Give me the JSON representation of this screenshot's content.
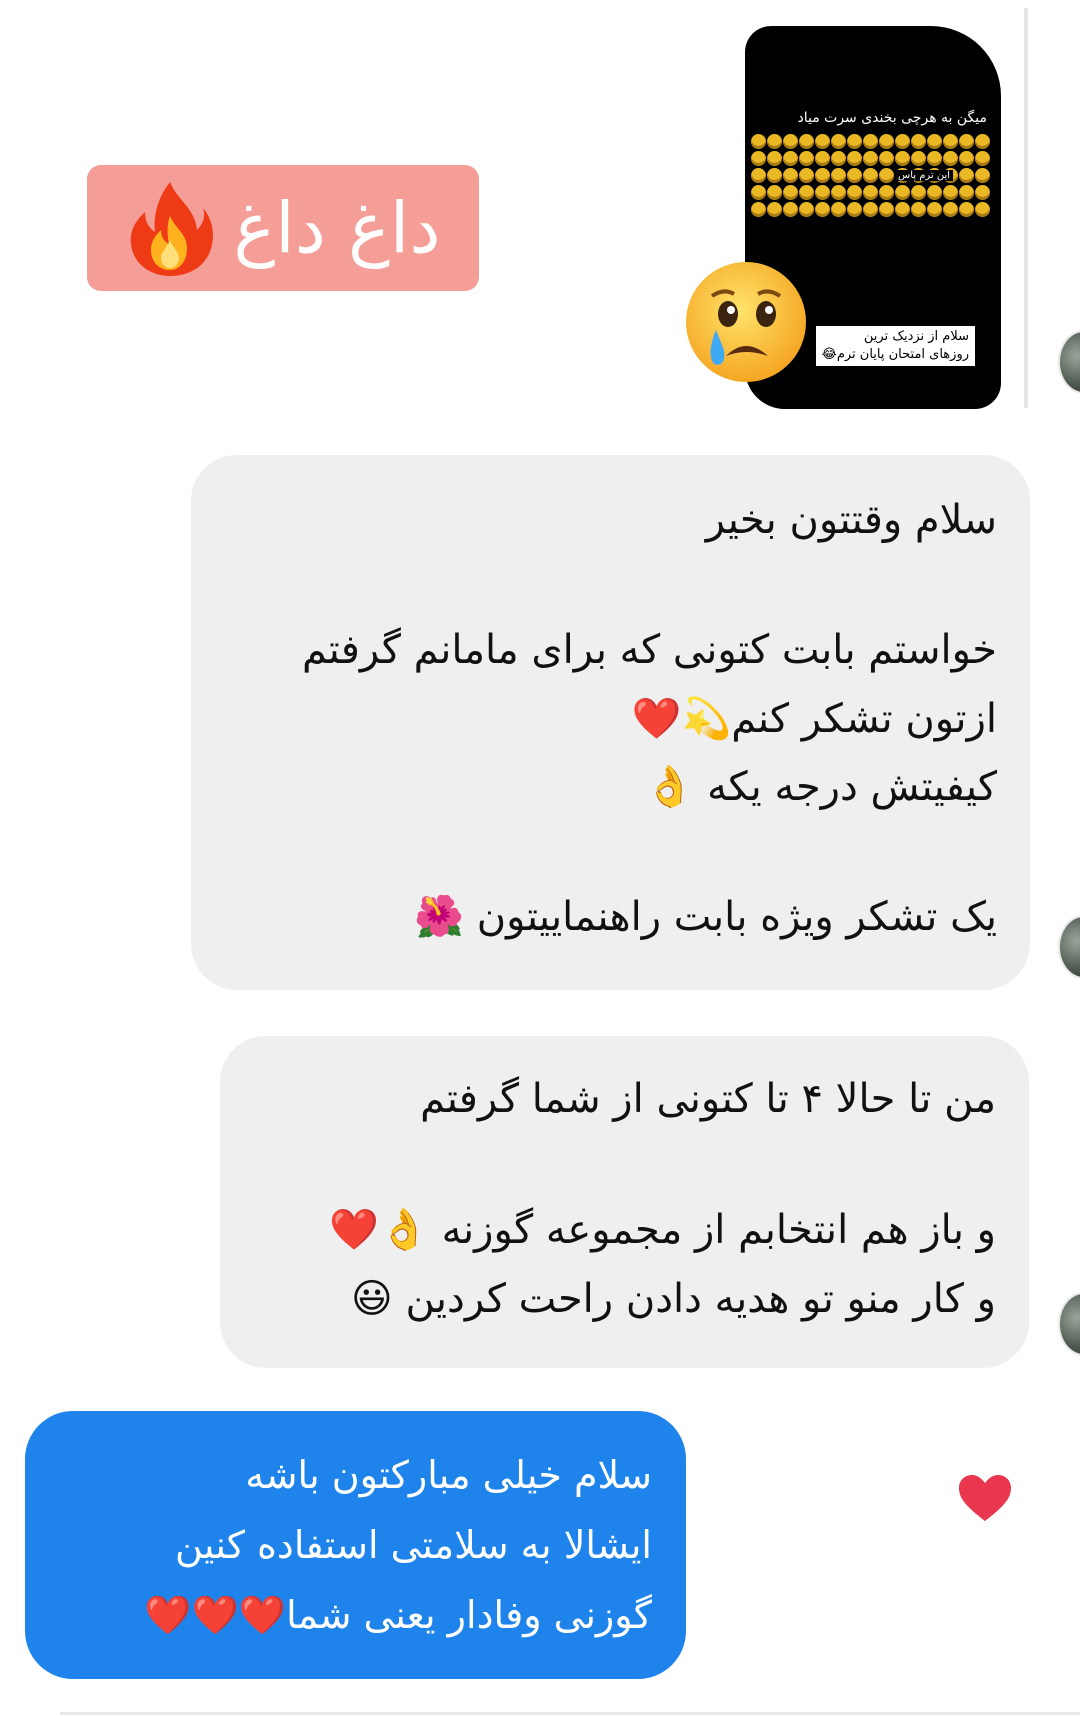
{
  "badge": {
    "text": "داغ داغ",
    "icon": "fire-icon"
  },
  "story": {
    "top_text": "میگن به هرچی بخندی سرت میاد",
    "pass_text": "این ترم پاس",
    "label_line1": "سلام از نزدیک ترین",
    "label_line2": "روزهای امتحان پایان ترم😂",
    "emoji_icon": "crying-face-icon"
  },
  "messages": {
    "m1": {
      "line1": "سلام وقتتون بخیر",
      "line2": "خواستم بابت کتونی که برای مامانم گرفتم",
      "line3": "ازتون تشکر کنم💫❤️",
      "line4": "کیفیتش درجه یکه 👌",
      "line5": "یک تشکر ویژه  بابت راهنماییتون 🌺"
    },
    "m2": {
      "line1": "من تا حالا ۴ تا کتونی از شما گرفتم",
      "line2": "و باز هم انتخابم از مجموعه گوزنه 👌❤️",
      "line3": "و کار منو تو هدیه دادن راحت کردین 😃"
    },
    "reply": {
      "line1": "سلام خیلی مبارکتون باشه",
      "line2": "ایشالا به سلامتی استفاده کنین",
      "line3": "گوزنی وفادار یعنی شما❤️❤️❤️"
    }
  },
  "reaction": {
    "icon": "heart-reaction-icon",
    "color": "#e8374e"
  },
  "colors": {
    "sent_bubble": "#1e84ec",
    "received_bubble": "#efefef",
    "badge_bg": "#f59d97"
  }
}
